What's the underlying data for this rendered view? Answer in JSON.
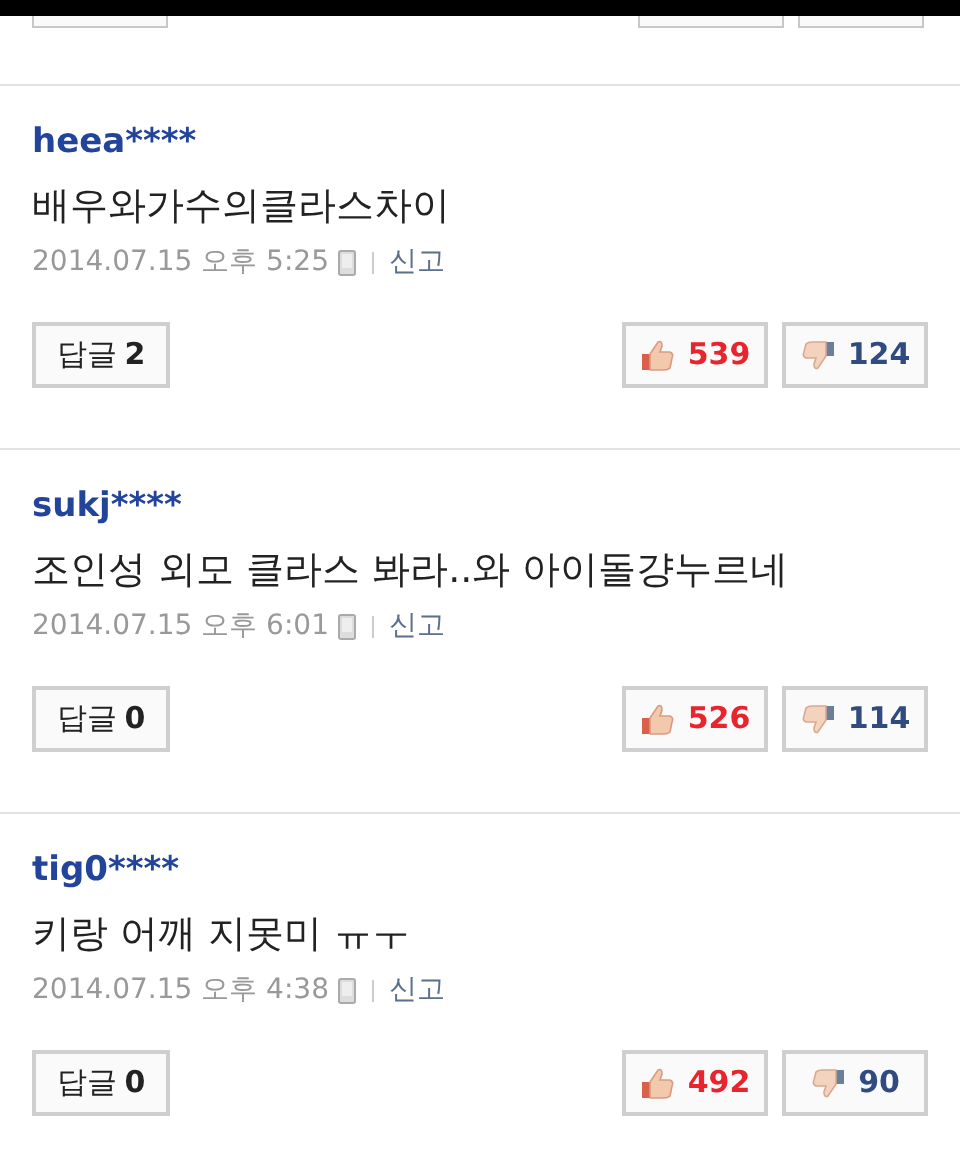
{
  "comments": [
    {
      "user": "heea****",
      "text": "배우와가수의클라스차이",
      "date": "2014.07.15 오후 5:25",
      "report": "신고",
      "reply_label": "답글",
      "reply_count": "2",
      "likes": "539",
      "dislikes": "124"
    },
    {
      "user": "sukj****",
      "text": "조인성 외모 클라스 봐라..와 아이돌걍누르네",
      "date": "2014.07.15 오후 6:01",
      "report": "신고",
      "reply_label": "답글",
      "reply_count": "0",
      "likes": "526",
      "dislikes": "114"
    },
    {
      "user": "tig0****",
      "text": "키랑 어깨 지못미 ㅠㅜ",
      "date": "2014.07.15 오후 4:38",
      "report": "신고",
      "reply_label": "답글",
      "reply_count": "0",
      "likes": "492",
      "dislikes": "90"
    }
  ]
}
